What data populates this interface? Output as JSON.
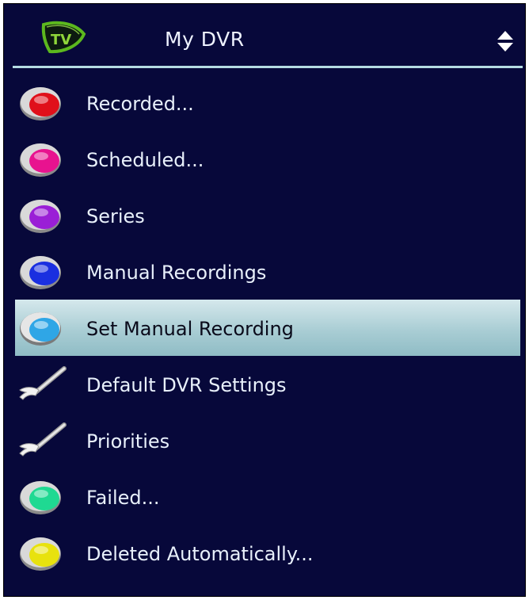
{
  "header": {
    "title": "My DVR",
    "logo_text": "TV",
    "logo_icon": "tv-logo-icon",
    "sort_icon": "sort-updown-icon"
  },
  "menu": {
    "items": [
      {
        "label": "Recorded...",
        "icon": "red-button-icon",
        "color": "#e0101a"
      },
      {
        "label": "Scheduled...",
        "icon": "magenta-button-icon",
        "color": "#e8138f"
      },
      {
        "label": "Series",
        "icon": "purple-button-icon",
        "color": "#9a1fd6"
      },
      {
        "label": "Manual Recordings",
        "icon": "blue-button-icon",
        "color": "#1a2fe0"
      },
      {
        "label": "Set Manual Recording",
        "icon": "light-blue-button-icon",
        "color": "#2fa6e6",
        "selected": true
      },
      {
        "label": "Default DVR Settings",
        "icon": "wrench-icon"
      },
      {
        "label": "Priorities",
        "icon": "wrench-icon"
      },
      {
        "label": "Failed...",
        "icon": "green-button-icon",
        "color": "#1fd992"
      },
      {
        "label": "Deleted Automatically...",
        "icon": "yellow-button-icon",
        "color": "#e8e20e"
      }
    ]
  },
  "colors": {
    "background": "#07083a",
    "divider": "#b4dbe2",
    "highlight": "#a9cdd4",
    "logo_green": "#5cb81e"
  }
}
